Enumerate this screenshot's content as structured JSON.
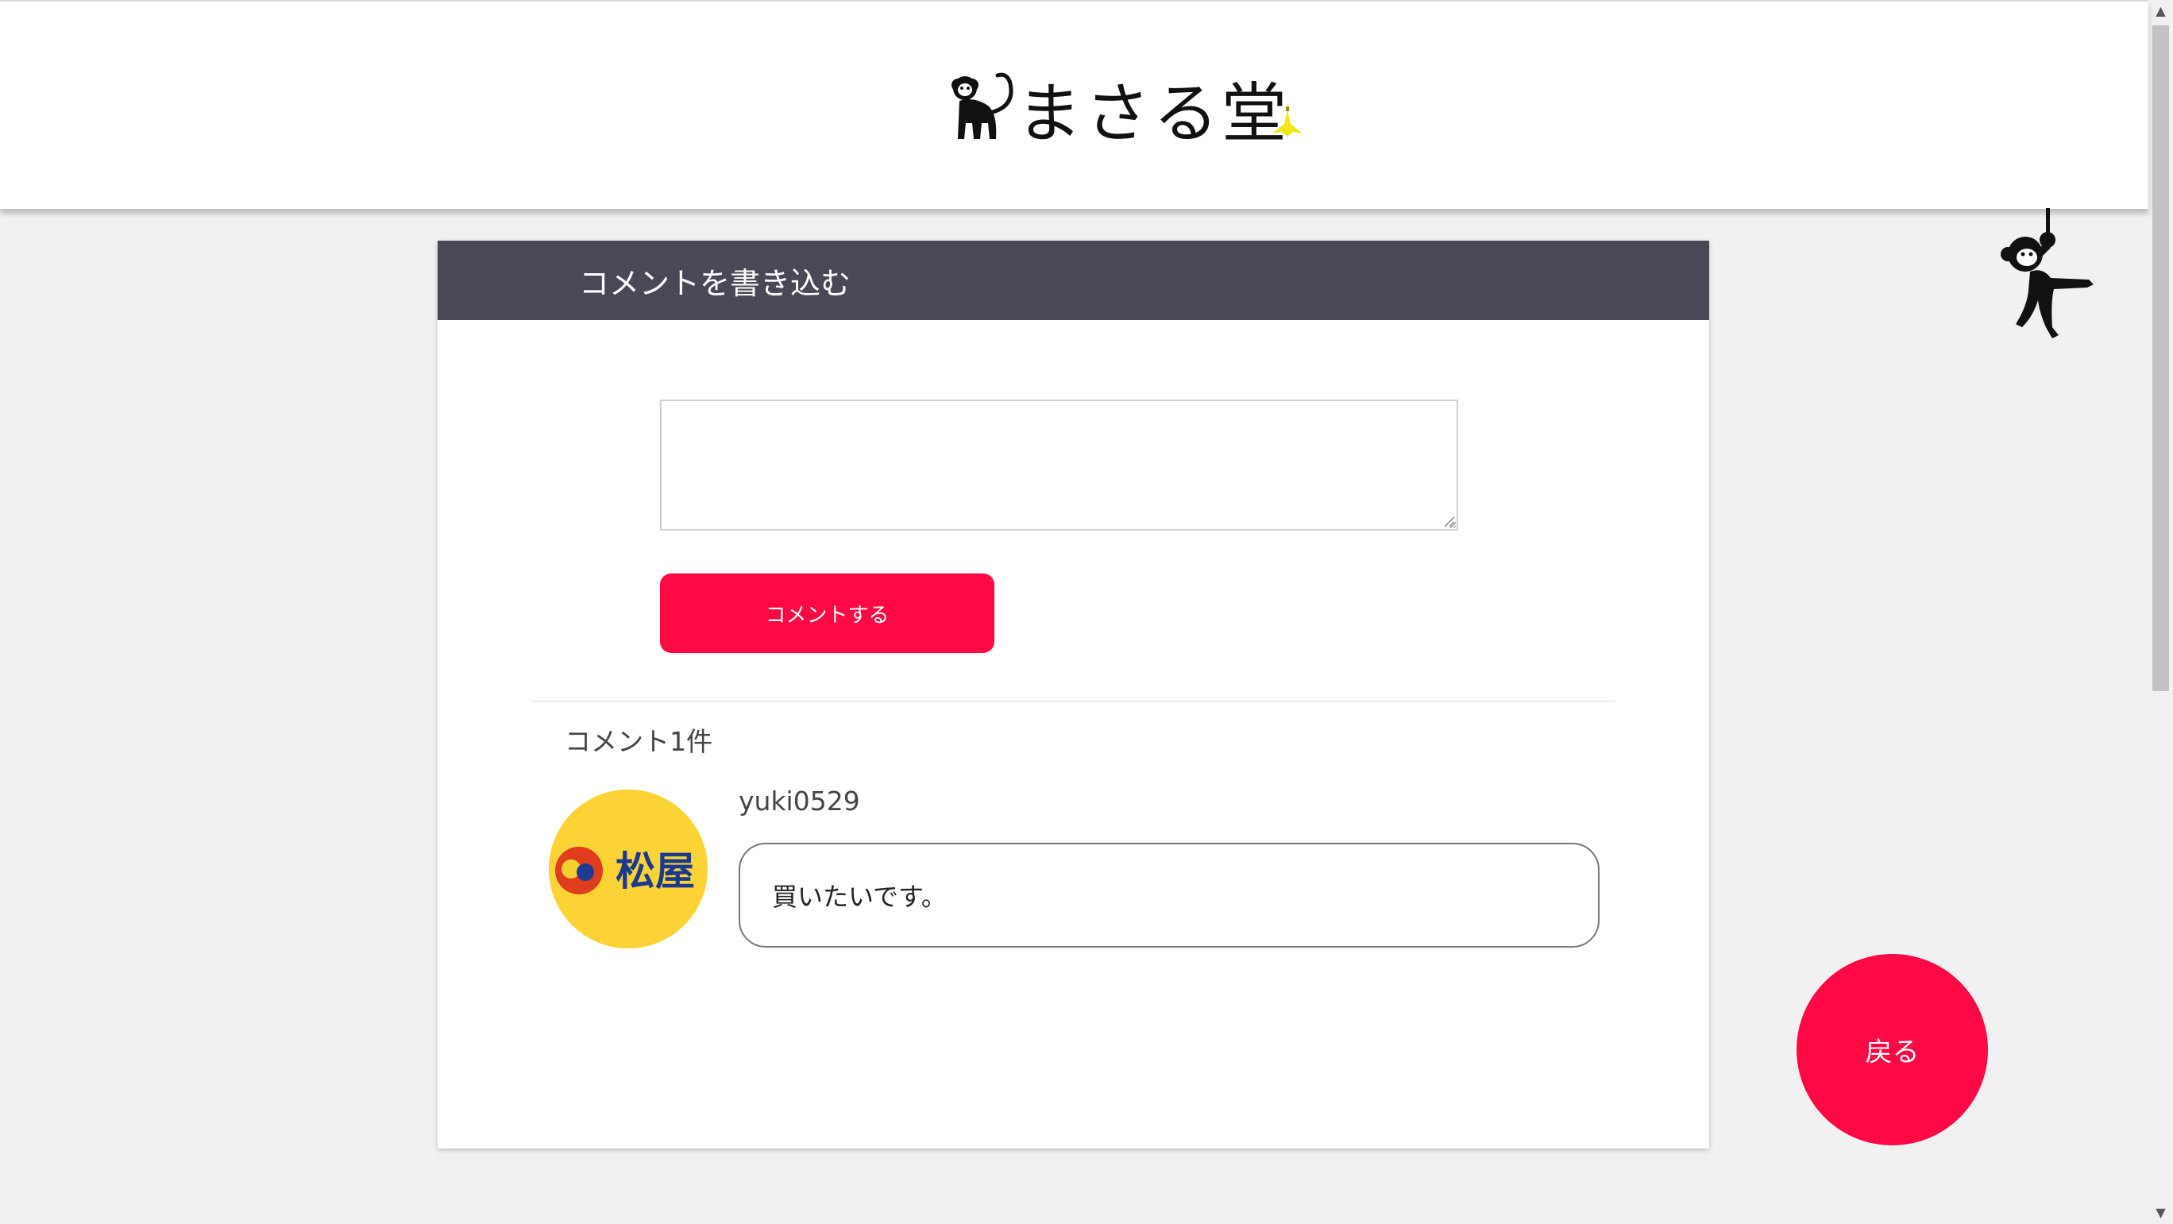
{
  "header": {
    "logo_text": "まさる堂",
    "logo_icon": "monkey-icon",
    "banana_icon": "banana-icon"
  },
  "decor": {
    "hanging_monkey_icon": "hanging-monkey-icon"
  },
  "comment_form": {
    "title": "コメントを書き込む",
    "textarea_value": "",
    "submit_label": "コメントする"
  },
  "comments": {
    "count_label": "コメント1件",
    "items": [
      {
        "username": "yuki0529",
        "avatar_logo_text": "松屋",
        "text": "買いたいです。"
      }
    ]
  },
  "actions": {
    "back_label": "戻る"
  },
  "colors": {
    "accent": "#ff0844",
    "card_header": "#494857",
    "page_bg": "#f1f1f1",
    "banana": "#f5e51b",
    "avatar_bg": "#fbd335"
  }
}
